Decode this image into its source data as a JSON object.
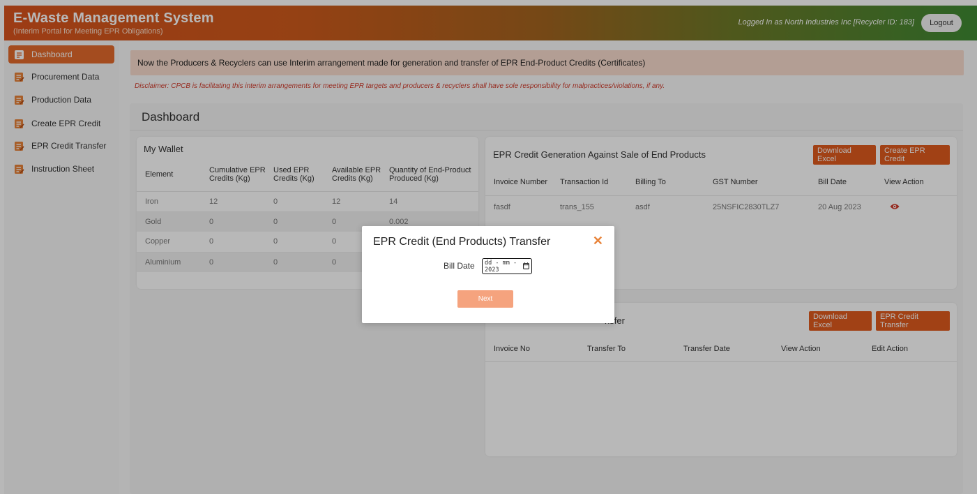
{
  "header": {
    "title": "E-Waste Management System",
    "subtitle": "(Interim Portal for Meeting EPR Obligations)",
    "login_info": "Logged In as North Industries Inc [Recycler ID: 183]",
    "logout_label": "Logout"
  },
  "sidebar": {
    "items": [
      {
        "label": "Dashboard",
        "icon": "document-icon",
        "active": true
      },
      {
        "label": "Procurement Data",
        "icon": "document-icon"
      },
      {
        "label": "Production Data",
        "icon": "document-icon"
      },
      {
        "label": "Create EPR Credit",
        "icon": "document-icon"
      },
      {
        "label": "EPR Credit Transfer",
        "icon": "document-icon"
      },
      {
        "label": "Instruction Sheet",
        "icon": "document-icon"
      }
    ]
  },
  "notice": "Now the Producers & Recyclers can use Interim arrangement made for generation and transfer of EPR End-Product Credits (Certificates)",
  "disclaimer": "Disclaimer: CPCB is facilitating this interim arrangements for meeting EPR targets and producers & recyclers shall have sole responsibility for malpractices/violations, if any.",
  "dashboard": {
    "title": "Dashboard",
    "wallet": {
      "title": "My Wallet",
      "headers": [
        "Element",
        "Cumulative EPR Credits (Kg)",
        "Used EPR Credits (Kg)",
        "Available EPR Credits (Kg)",
        "Quantity of End-Product Produced (Kg)"
      ],
      "rows": [
        [
          "Iron",
          "12",
          "0",
          "12",
          "14"
        ],
        [
          "Gold",
          "0",
          "0",
          "0",
          "0.002"
        ],
        [
          "Copper",
          "0",
          "0",
          "0",
          ""
        ],
        [
          "Aluminium",
          "0",
          "0",
          "0",
          ""
        ]
      ]
    },
    "generation": {
      "title": "EPR Credit Generation Against Sale of End Products",
      "download_label": "Download Excel",
      "create_label": "Create EPR Credit",
      "headers": [
        "Invoice Number",
        "Transaction Id",
        "Billing To",
        "GST Number",
        "Bill Date",
        "View Action"
      ],
      "rows": [
        [
          "fasdf",
          "trans_155",
          "asdf",
          "25NSFIC2830TLZ7",
          "20 Aug 2023"
        ]
      ]
    },
    "transfer": {
      "title_visible": "nsfer",
      "download_label": "Download Excel",
      "transfer_label": "EPR Credit Transfer",
      "headers": [
        "Invoice No",
        "Transfer To",
        "Transfer Date",
        "View Action",
        "Edit Action"
      ]
    }
  },
  "modal": {
    "title": "EPR Credit (End Products) Transfer",
    "close_glyph": "✕",
    "bill_date_label": "Bill Date",
    "bill_date_value": "dd - mm - 2023",
    "next_label": "Next"
  },
  "colors": {
    "accent": "#e05a1e",
    "notice_bg": "#f8dccd",
    "disclaimer": "#d03b2b"
  }
}
